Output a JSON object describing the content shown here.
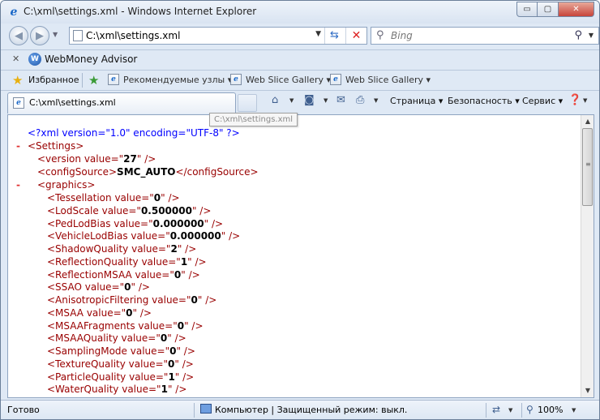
{
  "window": {
    "title": "C:\\xml\\settings.xml - Windows Internet Explorer",
    "minimize_glyph": "▭",
    "maximize_glyph": "▢",
    "close_glyph": "✕"
  },
  "address_bar": {
    "url": "C:\\xml\\settings.xml"
  },
  "search": {
    "placeholder": "Bing"
  },
  "toolbar": {
    "close_glyph": "✕",
    "webmoney_label": "WebMoney Advisor",
    "webmoney_logo_glyph": "W"
  },
  "favorites_bar": {
    "favorites_label": "Избранное",
    "items": [
      {
        "label": "Рекомендуемые узлы ▾"
      },
      {
        "label": "Web Slice Gallery ▾"
      },
      {
        "label": "Web Slice Gallery ▾"
      }
    ]
  },
  "tab": {
    "title": "C:\\xml\\settings.xml"
  },
  "command_bar": {
    "page_label": "Страница",
    "safety_label": "Безопасность",
    "tools_label": "Сервис"
  },
  "tooltip": {
    "text": "C:\\xml\\settings.xml"
  },
  "xml_document": {
    "declaration": "<?xml version=\"1.0\" encoding=\"UTF-8\" ?>",
    "root_open": "<Settings>",
    "collapse_glyph": "-",
    "version": {
      "open": "<version value=\"",
      "value": "27",
      "close": "\" />"
    },
    "config_source": {
      "open": "<configSource>",
      "value": "SMC_AUTO",
      "close": "</configSource>"
    },
    "graphics_open": "<graphics>",
    "settings": [
      {
        "name": "Tessellation",
        "value": "0"
      },
      {
        "name": "LodScale",
        "value": "0.500000"
      },
      {
        "name": "PedLodBias",
        "value": "0.000000"
      },
      {
        "name": "VehicleLodBias",
        "value": "0.000000"
      },
      {
        "name": "ShadowQuality",
        "value": "2"
      },
      {
        "name": "ReflectionQuality",
        "value": "1"
      },
      {
        "name": "ReflectionMSAA",
        "value": "0"
      },
      {
        "name": "SSAO",
        "value": "0"
      },
      {
        "name": "AnisotropicFiltering",
        "value": "0"
      },
      {
        "name": "MSAA",
        "value": "0"
      },
      {
        "name": "MSAAFragments",
        "value": "0"
      },
      {
        "name": "MSAAQuality",
        "value": "0"
      },
      {
        "name": "SamplingMode",
        "value": "0"
      },
      {
        "name": "TextureQuality",
        "value": "0"
      },
      {
        "name": "ParticleQuality",
        "value": "1"
      },
      {
        "name": "WaterQuality",
        "value": "1"
      }
    ]
  },
  "status_bar": {
    "status_text": "Готово",
    "zone_text": "Компьютер | Защищенный режим: выкл.",
    "zoom": "100%"
  },
  "colors": {
    "tag": "#990000",
    "bracket": "#0000ff",
    "collapse_toggle": "#e03030"
  }
}
